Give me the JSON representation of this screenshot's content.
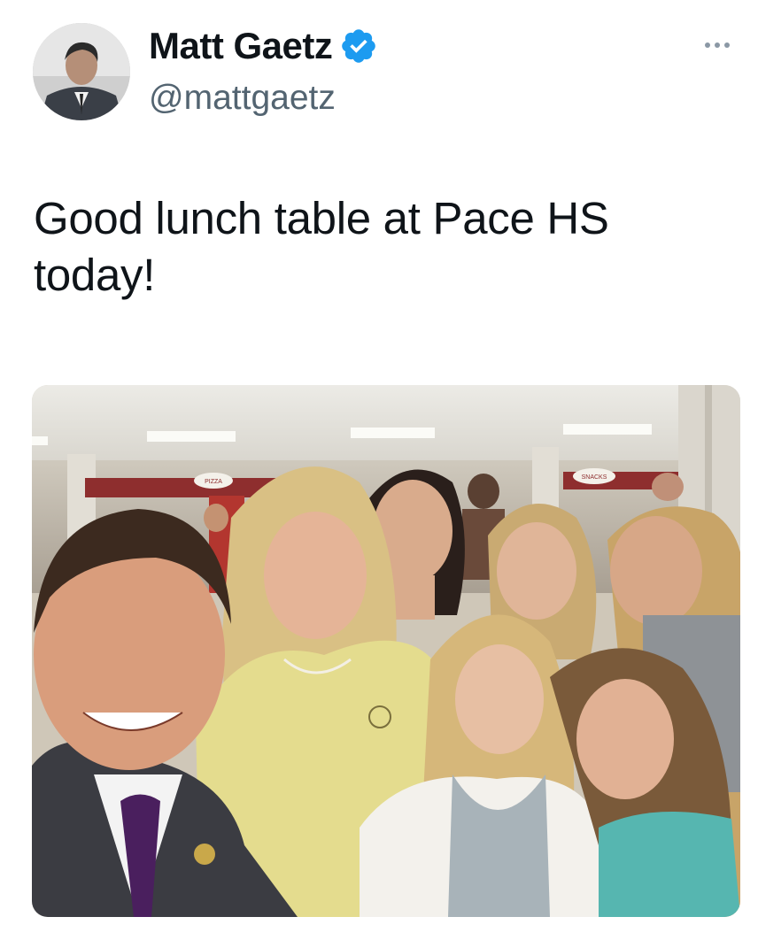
{
  "author": {
    "display_name": "Matt Gaetz",
    "handle": "@mattgaetz",
    "verified_icon": "verified-badge-icon",
    "avatar_icon": "avatar-photo"
  },
  "tweet": {
    "text_line1": "Good lunch table at Pace HS",
    "text_line2": "today!"
  },
  "media": {
    "photo_kind": "selfie-photo",
    "signs": [
      "PIZZA",
      "SNACKS"
    ]
  },
  "colors": {
    "verified_blue": "#1d9bf0",
    "handle_gray": "#536471",
    "text": "#0f1419"
  }
}
